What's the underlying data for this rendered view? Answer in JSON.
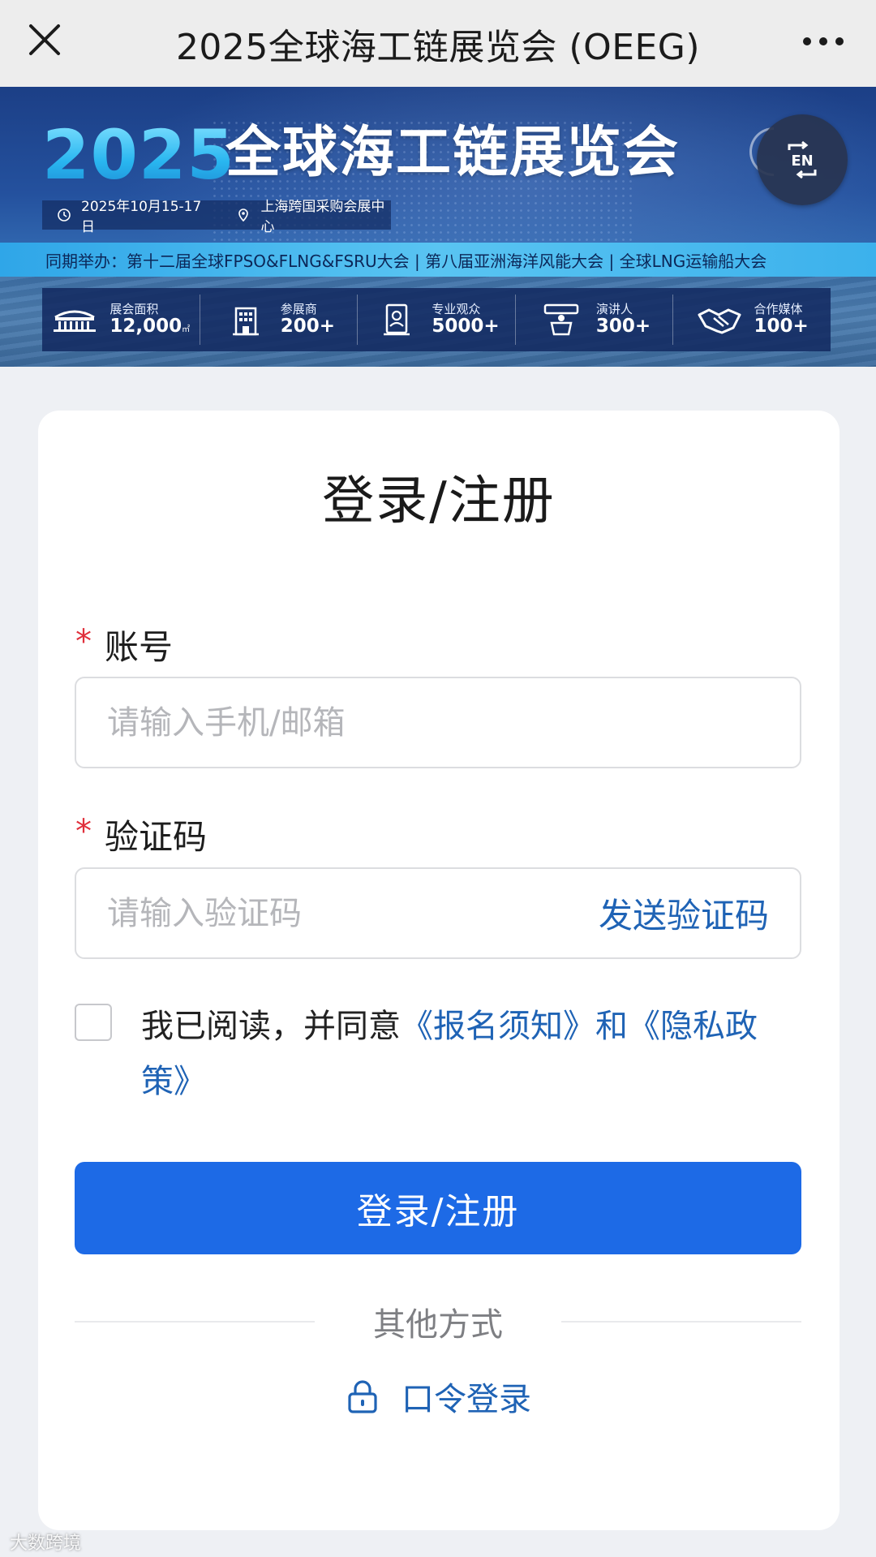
{
  "topbar": {
    "title": "2025全球海工链展览会 (OEEG)",
    "close_icon": "close-icon",
    "more_icon": "more-dots-icon"
  },
  "banner": {
    "year": "2025",
    "name": "全球海工链展览会",
    "date": "2025年10月15-17日",
    "venue": "上海跨国采购会展中心",
    "cohost": "同期举办：第十二届全球FPSO&FLNG&FSRU大会 | 第八届亚洲海洋风能大会 | 全球LNG运输船大会",
    "stats": [
      {
        "label": "展会面积",
        "value": "12,000",
        "unit": "㎡",
        "icon": "stadium-icon"
      },
      {
        "label": "参展商",
        "value": "200+",
        "icon": "building-icon"
      },
      {
        "label": "专业观众",
        "value": "5000+",
        "icon": "badge-icon"
      },
      {
        "label": "演讲人",
        "value": "300+",
        "icon": "podium-icon"
      },
      {
        "label": "合作媒体",
        "value": "100+",
        "icon": "handshake-icon"
      }
    ],
    "lang_button": "EN"
  },
  "form": {
    "heading": "登录/注册",
    "account": {
      "label": "账号",
      "required_mark": "*",
      "placeholder": "请输入手机/邮箱",
      "value": ""
    },
    "code": {
      "label": "验证码",
      "required_mark": "*",
      "placeholder": "请输入验证码",
      "value": "",
      "send_label": "发送验证码"
    },
    "agreement": {
      "checked": false,
      "prefix": "我已阅读，并同意",
      "link1": "《报名须知》",
      "middle": "和",
      "link2": "《隐私政策》"
    },
    "submit_label": "登录/注册",
    "divider_label": "其他方式",
    "alt_login_label": "口令登录"
  },
  "watermark": "大数跨境",
  "colors": {
    "primary": "#1d6ae6",
    "link": "#1f63b5",
    "required": "#e0303c",
    "page_bg": "#eef0f4"
  }
}
